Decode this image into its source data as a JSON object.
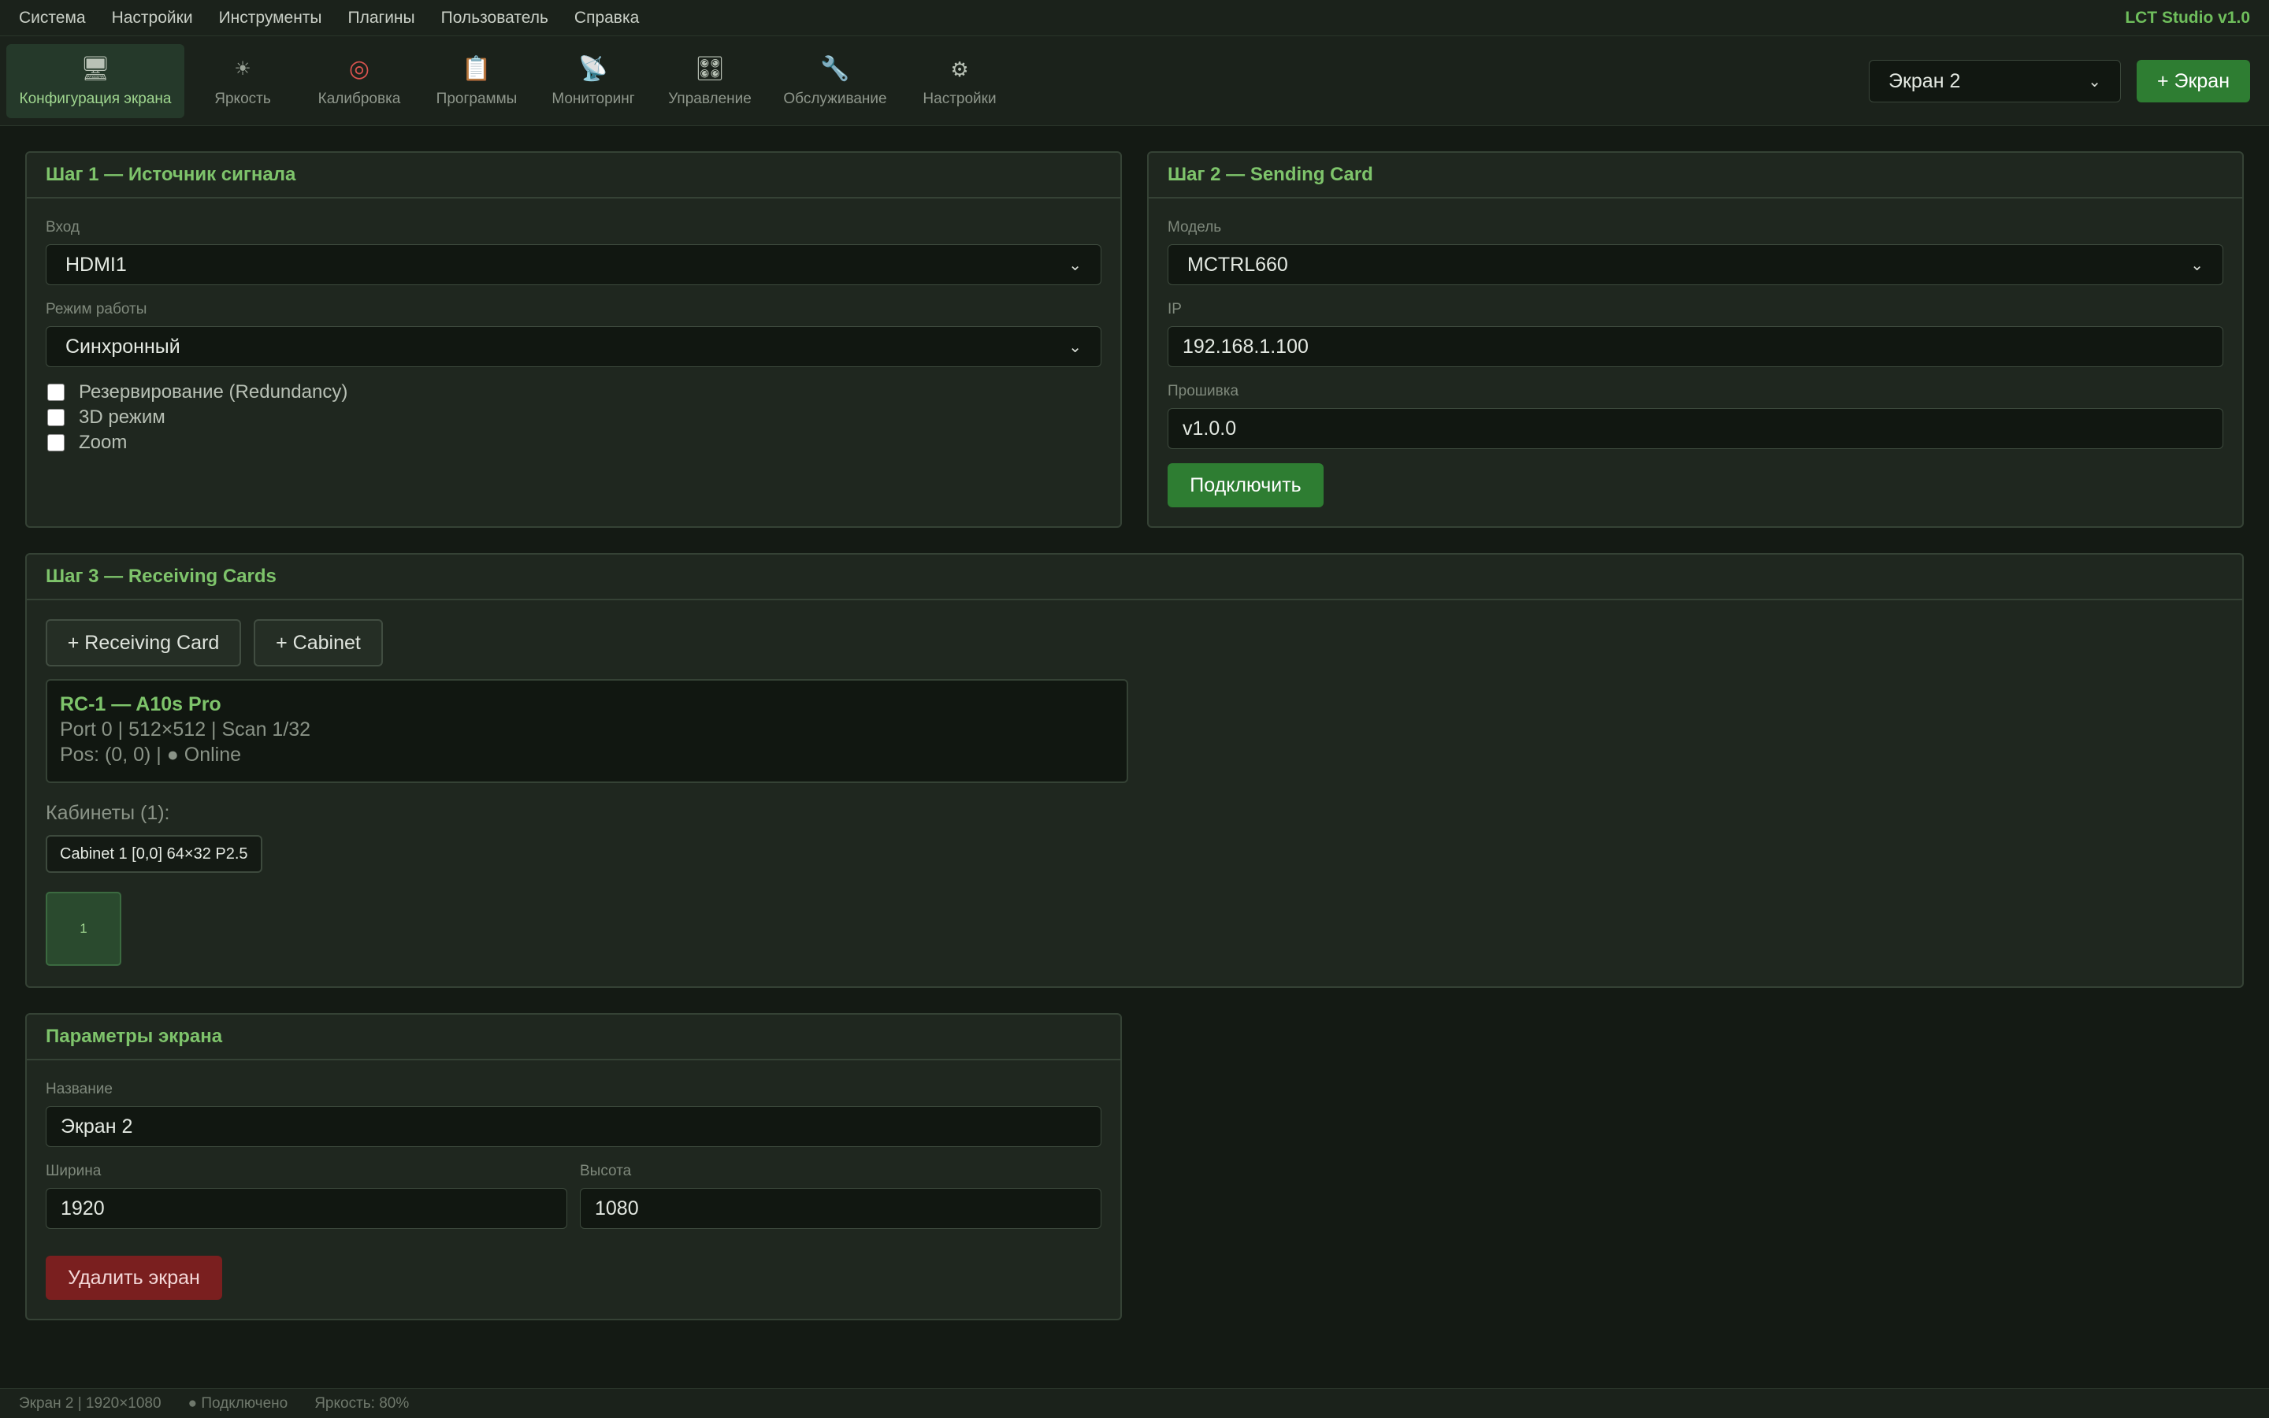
{
  "menubar": {
    "items": [
      "Система",
      "Настройки",
      "Инструменты",
      "Плагины",
      "Пользователь",
      "Справка"
    ],
    "brand": "LCT Studio v1.0"
  },
  "toolbar": {
    "tools": [
      {
        "label": "Конфигурация экрана",
        "icon": "monitor-icon"
      },
      {
        "label": "Яркость",
        "icon": "sun-icon"
      },
      {
        "label": "Калибровка",
        "icon": "target-icon"
      },
      {
        "label": "Программы",
        "icon": "clipboard-icon"
      },
      {
        "label": "Мониторинг",
        "icon": "satellite-icon"
      },
      {
        "label": "Управление",
        "icon": "control-knobs-icon"
      },
      {
        "label": "Обслуживание",
        "icon": "wrench-icon"
      },
      {
        "label": "Настройки",
        "icon": "gear-icon"
      }
    ],
    "active_index": 0,
    "screen_select_value": "Экран 2",
    "add_screen_label": "+ Экран"
  },
  "step1": {
    "title": "Шаг 1 — Источник сигнала",
    "input_label": "Вход",
    "input_value": "HDMI1",
    "mode_label": "Режим работы",
    "mode_value": "Синхронный",
    "checkboxes": [
      {
        "label": "Резервирование (Redundancy)",
        "checked": false
      },
      {
        "label": "3D режим",
        "checked": false
      },
      {
        "label": "Zoom",
        "checked": false
      }
    ]
  },
  "step2": {
    "title": "Шаг 2 — Sending Card",
    "model_label": "Модель",
    "model_value": "MCTRL660",
    "ip_label": "IP",
    "ip_value": "192.168.1.100",
    "firmware_label": "Прошивка",
    "firmware_value": "v1.0.0",
    "connect_label": "Подключить"
  },
  "step3": {
    "title": "Шаг 3 — Receiving Cards",
    "add_rc_label": "+ Receiving Card",
    "add_cabinet_label": "+ Cabinet",
    "card": {
      "title": "RC-1 — A10s Pro",
      "line1": "Port 0 | 512×512 | Scan 1/32",
      "line2": "Pos: (0, 0) | ● Online"
    },
    "cabinets_label": "Кабинеты (1):",
    "cabinet_tag": "Cabinet 1 [0,0] 64×32 P2.5",
    "cabinet_cell": "1"
  },
  "params": {
    "title": "Параметры экрана",
    "name_label": "Название",
    "name_value": "Экран 2",
    "width_label": "Ширина",
    "width_value": "1920",
    "height_label": "Высота",
    "height_value": "1080",
    "delete_label": "Удалить экран"
  },
  "statusbar": {
    "screen": "Экран 2 | 1920×1080",
    "connection": "● Подключено",
    "brightness": "Яркость: 80%"
  },
  "colors": {
    "accent": "#7ec46b",
    "primary_button": "#2e7d32",
    "danger_button": "#7a1f1f",
    "background": "#141a14"
  }
}
